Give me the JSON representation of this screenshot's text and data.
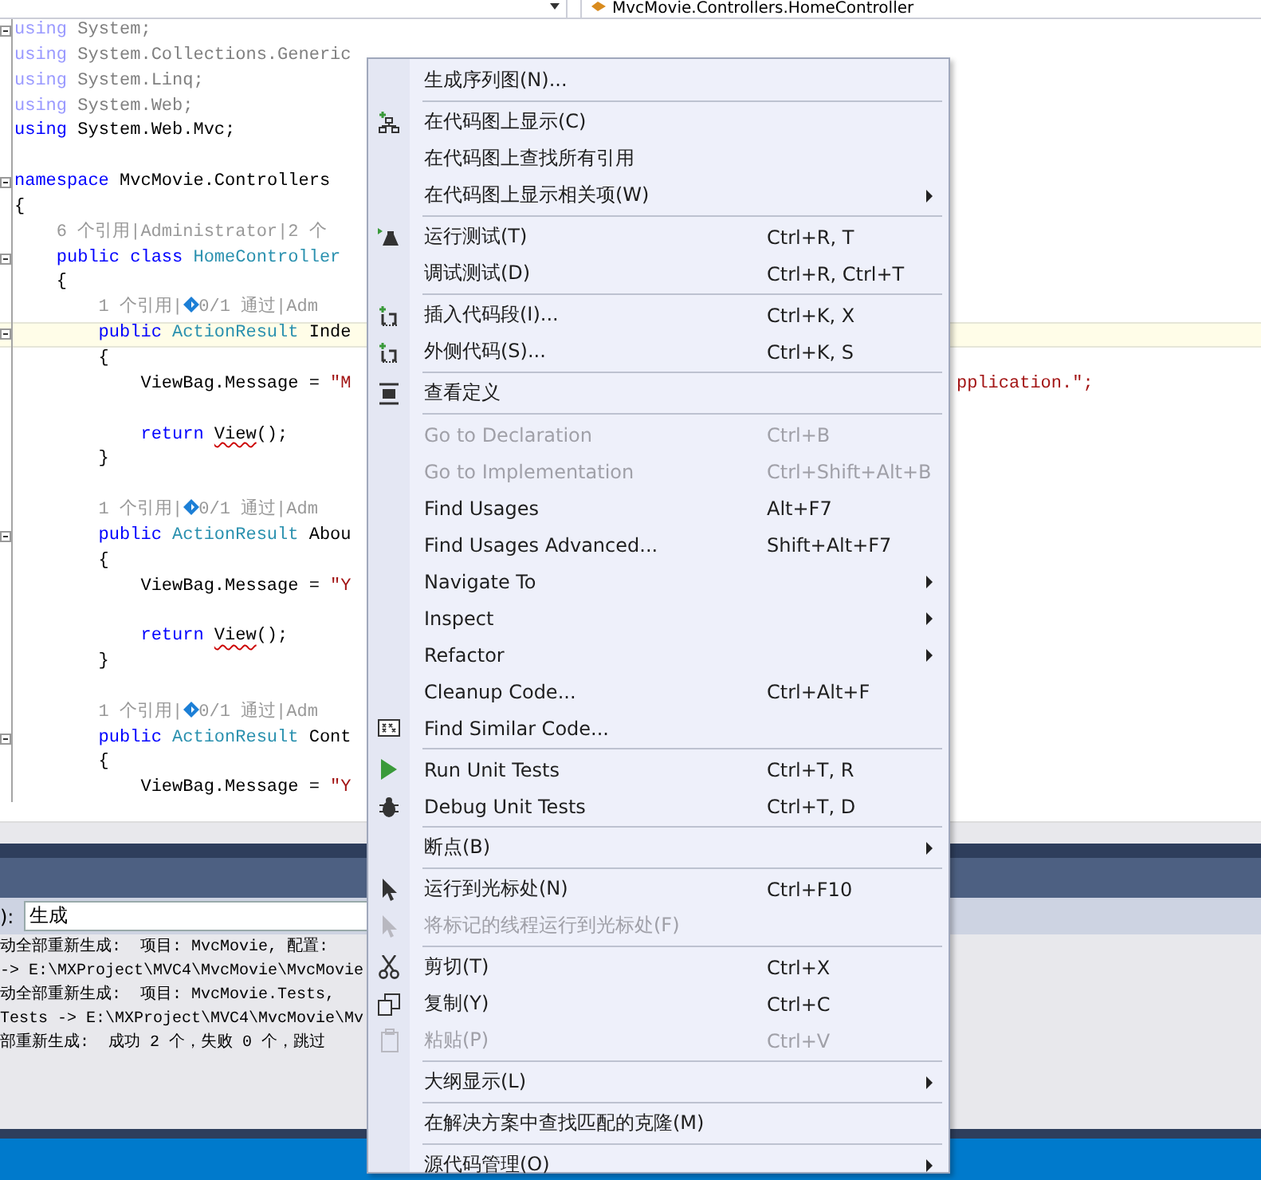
{
  "top_bar": {
    "class_dropdown": "MvcMovie.Controllers.HomeController"
  },
  "editor": {
    "lines": [
      {
        "fold": true,
        "highlighted": false,
        "tokens": [
          {
            "kind": "faded-keyword",
            "text": "using"
          },
          {
            "kind": "faded",
            "text": " System;"
          }
        ]
      },
      {
        "fold": false,
        "highlighted": false,
        "tokens": [
          {
            "kind": "faded-keyword",
            "text": "using"
          },
          {
            "kind": "faded",
            "text": " System.Collections.Generic"
          }
        ]
      },
      {
        "fold": false,
        "highlighted": false,
        "tokens": [
          {
            "kind": "faded-keyword",
            "text": "using"
          },
          {
            "kind": "faded",
            "text": " System.Linq;"
          }
        ]
      },
      {
        "fold": false,
        "highlighted": false,
        "tokens": [
          {
            "kind": "faded-keyword",
            "text": "using"
          },
          {
            "kind": "faded",
            "text": " System.Web;"
          }
        ]
      },
      {
        "fold": false,
        "highlighted": false,
        "tokens": [
          {
            "kind": "keyword",
            "text": "using"
          },
          {
            "kind": "plain",
            "text": " System.Web.Mvc;"
          }
        ]
      },
      {
        "fold": false,
        "highlighted": false
      },
      {
        "fold": true,
        "highlighted": false,
        "tokens": [
          {
            "kind": "keyword",
            "text": "namespace"
          },
          {
            "kind": "plain",
            "text": " MvcMovie.Controllers"
          }
        ]
      },
      {
        "fold": false,
        "highlighted": false,
        "tokens": [
          {
            "kind": "plain",
            "text": "{"
          }
        ]
      },
      {
        "fold": false,
        "highlighted": false,
        "tokens": [
          {
            "kind": "lens",
            "text": "    6 个引用|Administrator|2 个"
          }
        ]
      },
      {
        "fold": true,
        "highlighted": false,
        "tokens": [
          {
            "kind": "keyword",
            "text": "    public class"
          },
          {
            "kind": "type",
            "text": " HomeController"
          }
        ]
      },
      {
        "fold": false,
        "highlighted": false,
        "tokens": [
          {
            "kind": "plain",
            "text": "    {"
          }
        ]
      },
      {
        "fold": false,
        "highlighted": false,
        "tokens": [
          {
            "kind": "lens",
            "text": "        1 个引用|"
          },
          {
            "kind": "test-icon"
          },
          {
            "kind": "lens",
            "text": "0/1 通过|Adm"
          }
        ]
      },
      {
        "fold": true,
        "highlighted": true,
        "tokens": [
          {
            "kind": "keyword",
            "text": "        public"
          },
          {
            "kind": "type",
            "text": " ActionResult"
          },
          {
            "kind": "plain",
            "text": " Inde"
          }
        ]
      },
      {
        "fold": false,
        "highlighted": false,
        "tokens": [
          {
            "kind": "plain",
            "text": "        {"
          }
        ]
      },
      {
        "fold": false,
        "highlighted": false,
        "tokens": [
          {
            "kind": "plain",
            "text": "            ViewBag.Message = "
          },
          {
            "kind": "string",
            "text": "\"M"
          }
        ],
        "tail": "pplication.\";"
      },
      {
        "fold": false,
        "highlighted": false
      },
      {
        "fold": false,
        "highlighted": false,
        "tokens": [
          {
            "kind": "keyword",
            "text": "            return "
          },
          {
            "kind": "error",
            "text": "View"
          },
          {
            "kind": "plain",
            "text": "();"
          }
        ]
      },
      {
        "fold": false,
        "highlighted": false,
        "tokens": [
          {
            "kind": "plain",
            "text": "        }"
          }
        ]
      },
      {
        "fold": false,
        "highlighted": false
      },
      {
        "fold": false,
        "highlighted": false,
        "tokens": [
          {
            "kind": "lens",
            "text": "        1 个引用|"
          },
          {
            "kind": "test-icon"
          },
          {
            "kind": "lens",
            "text": "0/1 通过|Adm"
          }
        ]
      },
      {
        "fold": true,
        "highlighted": false,
        "tokens": [
          {
            "kind": "keyword",
            "text": "        public"
          },
          {
            "kind": "type",
            "text": " ActionResult"
          },
          {
            "kind": "plain",
            "text": " Abou"
          }
        ]
      },
      {
        "fold": false,
        "highlighted": false,
        "tokens": [
          {
            "kind": "plain",
            "text": "        {"
          }
        ]
      },
      {
        "fold": false,
        "highlighted": false,
        "tokens": [
          {
            "kind": "plain",
            "text": "            ViewBag.Message = "
          },
          {
            "kind": "string",
            "text": "\"Y"
          }
        ]
      },
      {
        "fold": false,
        "highlighted": false
      },
      {
        "fold": false,
        "highlighted": false,
        "tokens": [
          {
            "kind": "keyword",
            "text": "            return "
          },
          {
            "kind": "error",
            "text": "View"
          },
          {
            "kind": "plain",
            "text": "();"
          }
        ]
      },
      {
        "fold": false,
        "highlighted": false,
        "tokens": [
          {
            "kind": "plain",
            "text": "        }"
          }
        ]
      },
      {
        "fold": false,
        "highlighted": false
      },
      {
        "fold": false,
        "highlighted": false,
        "tokens": [
          {
            "kind": "lens",
            "text": "        1 个引用|"
          },
          {
            "kind": "test-icon"
          },
          {
            "kind": "lens",
            "text": "0/1 通过|Adm"
          }
        ]
      },
      {
        "fold": true,
        "highlighted": false,
        "tokens": [
          {
            "kind": "keyword",
            "text": "        public"
          },
          {
            "kind": "type",
            "text": " ActionResult"
          },
          {
            "kind": "plain",
            "text": " Cont"
          }
        ]
      },
      {
        "fold": false,
        "highlighted": false,
        "tokens": [
          {
            "kind": "plain",
            "text": "        {"
          }
        ]
      },
      {
        "fold": false,
        "highlighted": false,
        "tokens": [
          {
            "kind": "plain",
            "text": "            ViewBag.Message = "
          },
          {
            "kind": "string",
            "text": "\"Y"
          }
        ]
      }
    ]
  },
  "output": {
    "source_label": "):",
    "source_value": "生成",
    "lines": [
      "动全部重新生成:  项目: MvcMovie, 配置:",
      "-> E:\\MXProject\\MVC4\\MvcMovie\\MvcMovie",
      "动全部重新生成:  项目: MvcMovie.Tests,",
      "Tests -> E:\\MXProject\\MVC4\\MvcMovie\\Mv",
      "部重新生成:  成功 2 个，失败 0 个，跳过"
    ]
  },
  "context_menu": {
    "items": [
      {
        "kind": "item",
        "label": "生成序列图(N)...",
        "disabled": false,
        "submenu": false
      },
      {
        "kind": "separator"
      },
      {
        "kind": "item",
        "label": "在代码图上显示(C)",
        "disabled": false,
        "submenu": false
      },
      {
        "kind": "item",
        "label": "在代码图上查找所有引用",
        "disabled": false,
        "submenu": false
      },
      {
        "kind": "item",
        "label": "在代码图上显示相关项(W)",
        "disabled": false,
        "submenu": true
      },
      {
        "kind": "separator"
      },
      {
        "kind": "item",
        "label": "运行测试(T)",
        "shortcut": "Ctrl+R, T",
        "disabled": false,
        "submenu": false
      },
      {
        "kind": "item",
        "label": "调试测试(D)",
        "shortcut": "Ctrl+R, Ctrl+T",
        "disabled": false,
        "submenu": false
      },
      {
        "kind": "separator"
      },
      {
        "kind": "item",
        "label": "插入代码段(I)...",
        "shortcut": "Ctrl+K, X",
        "disabled": false,
        "submenu": false
      },
      {
        "kind": "item",
        "label": "外侧代码(S)...",
        "shortcut": "Ctrl+K, S",
        "disabled": false,
        "submenu": false
      },
      {
        "kind": "separator"
      },
      {
        "kind": "item",
        "label": "查看定义",
        "disabled": false,
        "submenu": false
      },
      {
        "kind": "separator"
      },
      {
        "kind": "item",
        "label": "Go to Declaration",
        "shortcut": "Ctrl+B",
        "disabled": true,
        "submenu": false
      },
      {
        "kind": "item",
        "label": "Go to Implementation",
        "shortcut": "Ctrl+Shift+Alt+B",
        "disabled": true,
        "submenu": false
      },
      {
        "kind": "item",
        "label": "Find Usages",
        "shortcut": "Alt+F7",
        "disabled": false,
        "submenu": false
      },
      {
        "kind": "item",
        "label": "Find Usages Advanced...",
        "shortcut": "Shift+Alt+F7",
        "disabled": false,
        "submenu": false
      },
      {
        "kind": "item",
        "label": "Navigate To",
        "disabled": false,
        "submenu": true
      },
      {
        "kind": "item",
        "label": "Inspect",
        "disabled": false,
        "submenu": true
      },
      {
        "kind": "item",
        "label": "Refactor",
        "disabled": false,
        "submenu": true
      },
      {
        "kind": "item",
        "label": "Cleanup Code...",
        "shortcut": "Ctrl+Alt+F",
        "disabled": false,
        "submenu": false
      },
      {
        "kind": "item",
        "label": "Find Similar Code...",
        "disabled": false,
        "submenu": false
      },
      {
        "kind": "separator"
      },
      {
        "kind": "item",
        "label": "Run Unit Tests",
        "shortcut": "Ctrl+T, R",
        "disabled": false,
        "submenu": false
      },
      {
        "kind": "item",
        "label": "Debug Unit Tests",
        "shortcut": "Ctrl+T, D",
        "disabled": false,
        "submenu": false
      },
      {
        "kind": "separator"
      },
      {
        "kind": "item",
        "label": "断点(B)",
        "disabled": false,
        "submenu": true
      },
      {
        "kind": "separator"
      },
      {
        "kind": "item",
        "label": "运行到光标处(N)",
        "shortcut": "Ctrl+F10",
        "disabled": false,
        "submenu": false
      },
      {
        "kind": "item",
        "label": "将标记的线程运行到光标处(F)",
        "disabled": true,
        "submenu": false
      },
      {
        "kind": "separator"
      },
      {
        "kind": "item",
        "label": "剪切(T)",
        "shortcut": "Ctrl+X",
        "disabled": false,
        "submenu": false
      },
      {
        "kind": "item",
        "label": "复制(Y)",
        "shortcut": "Ctrl+C",
        "disabled": false,
        "submenu": false
      },
      {
        "kind": "item",
        "label": "粘贴(P)",
        "shortcut": "Ctrl+V",
        "disabled": true,
        "submenu": false
      },
      {
        "kind": "separator"
      },
      {
        "kind": "item",
        "label": "大纲显示(L)",
        "disabled": false,
        "submenu": true
      },
      {
        "kind": "separator"
      },
      {
        "kind": "item",
        "label": "在解决方案中查找匹配的克隆(M)",
        "disabled": false,
        "submenu": false
      },
      {
        "kind": "separator"
      },
      {
        "kind": "item",
        "label": "源代码管理(O)",
        "disabled": false,
        "submenu": true
      }
    ]
  }
}
